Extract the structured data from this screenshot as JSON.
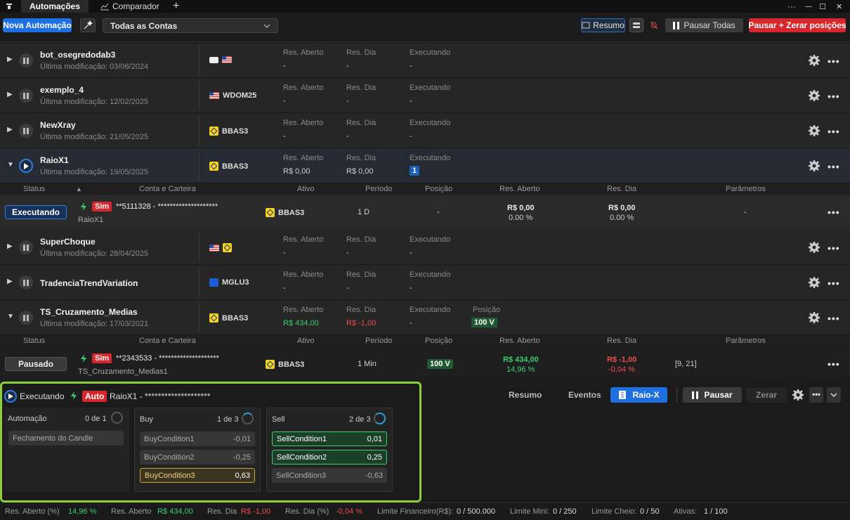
{
  "tabs": {
    "t1": "Automações",
    "t2": "Comparador",
    "add": "+"
  },
  "window": {
    "menu": "···",
    "min": "—",
    "max": "☐",
    "close": "✕"
  },
  "toolbar": {
    "new_automation": "Nova Automação",
    "account_select": "Todas as Contas",
    "summary": "Resumo",
    "pause_all": "Pausar Todas",
    "pause_zero": "Pausar + Zerar posições"
  },
  "labels": {
    "res_aberto": "Res. Aberto",
    "res_dia": "Res. Dia",
    "executando": "Executando",
    "posicao": "Posição",
    "dash": "-"
  },
  "rows": [
    {
      "name": "bot_osegredodab3",
      "modified": "Última modificação: 03/06/2024",
      "asset": ""
    },
    {
      "name": "exemplo_4",
      "modified": "Última modificação: 12/02/2025",
      "asset": "WDOM25"
    },
    {
      "name": "NewXray",
      "modified": "Última modificação: 21/05/2025",
      "asset": "BBAS3"
    },
    {
      "name": "RaioX1",
      "modified": "Última modificação: 19/05/2025",
      "asset": "BBAS3",
      "res_aberto": "R$ 0,00",
      "res_dia": "R$ 0,00",
      "executando": "1"
    },
    {
      "name": "SuperChoque",
      "modified": "Última modificação: 28/04/2025",
      "asset": ""
    },
    {
      "name": "TradenciaTrendVariation",
      "modified": "",
      "asset": "MGLU3"
    },
    {
      "name": "TS_Cruzamento_Medias",
      "modified": "Última modificação: 17/03/2021",
      "asset": "BBAS3",
      "res_aberto": "R$ 434,00",
      "res_dia": "R$ -1,00",
      "posicao": "100 V"
    }
  ],
  "subheader": {
    "status": "Status",
    "conta": "Conta e Carteira",
    "ativo": "Ativo",
    "periodo": "Período",
    "posicao": "Posição",
    "res_aberto": "Res. Aberto",
    "res_dia": "Res. Dia",
    "parametros": "Parâmetros"
  },
  "detail1": {
    "status": "Executando",
    "mode": "Sim",
    "account": "**5111328 - ********************",
    "name": "RaioX1",
    "asset": "BBAS3",
    "period": "1 D",
    "position": "-",
    "res_aberto": "R$ 0,00",
    "res_aberto_pct": "0.00 %",
    "res_dia": "R$ 0,00",
    "res_dia_pct": "0.00 %",
    "params": "-"
  },
  "detail2": {
    "status": "Pausado",
    "mode": "Sim",
    "account": "**2343533 - ********************",
    "name": "TS_Cruzamento_Medias1",
    "asset": "BBAS3",
    "period": "1 Min",
    "position": "100 V",
    "res_aberto": "R$ 434,00",
    "res_aberto_pct": "14,96 %",
    "res_dia": "R$ -1,00",
    "res_dia_pct": "-0,04 %",
    "params": "[9, 21]"
  },
  "xray": {
    "status": "Executando",
    "mode": "Auto",
    "account": "RaioX1 - ********************",
    "tabs": {
      "resumo": "Resumo",
      "eventos": "Eventos",
      "raiox": "Raio-X",
      "pausar": "Pausar",
      "zerar": "Zerar"
    },
    "automacao": {
      "title": "Automação",
      "count": "0 de 1",
      "conds": [
        {
          "label": "Fechamento do Candle",
          "value": ""
        }
      ]
    },
    "buy": {
      "title": "Buy",
      "count": "1 de 3",
      "conds": [
        {
          "label": "BuyCondition1",
          "value": "-0,01"
        },
        {
          "label": "BuyCondition2",
          "value": "-0,25"
        },
        {
          "label": "BuyCondition3",
          "value": "0,63"
        }
      ]
    },
    "sell": {
      "title": "Sell",
      "count": "2 de 3",
      "conds": [
        {
          "label": "SellCondition1",
          "value": "0,01"
        },
        {
          "label": "SellCondition2",
          "value": "0,25"
        },
        {
          "label": "SellCondition3",
          "value": "-0,63"
        }
      ]
    }
  },
  "statusbar": {
    "res_aberto_pct_label": "Res. Aberto (%)",
    "res_aberto_pct": "14,96 %",
    "res_aberto_label": "Res. Aberto",
    "res_aberto": "R$ 434,00",
    "res_dia_label": "Res. Dia",
    "res_dia": "R$ -1,00",
    "res_dia_pct_label": "Res. Dia (%)",
    "res_dia_pct": "-0,04 %",
    "limite_fin_label": "Limite Financeiro(R$):",
    "limite_fin": "0 / 500.000",
    "limite_mini_label": "Limite Mini:",
    "limite_mini": "0 / 250",
    "limite_cheio_label": "Limite Cheio:",
    "limite_cheio": "0 / 50",
    "ativas_label": "Ativas:",
    "ativas": "1 / 100"
  },
  "colors": {
    "accent": "#1e6fe0",
    "danger": "#d8262d",
    "success": "#3ccf6e",
    "highlight": "#8ccf3a"
  }
}
